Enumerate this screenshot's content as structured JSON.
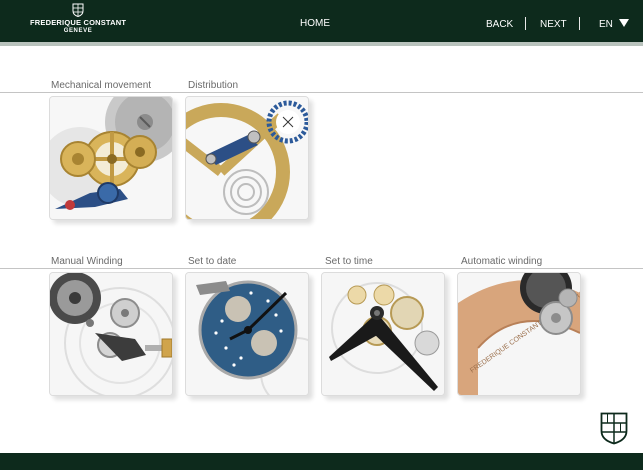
{
  "header": {
    "brand": "FREDERIQUE CONSTANT",
    "city": "GENEVE",
    "nav": {
      "home": "HOME",
      "back": "BACK",
      "next": "NEXT",
      "language": "EN"
    }
  },
  "sections": [
    {
      "items": [
        {
          "label": "Mechanical movement",
          "image": "gear-train-illustration"
        },
        {
          "label": "Distribution",
          "image": "balance-wheel-illustration"
        }
      ]
    },
    {
      "items": [
        {
          "label": "Manual Winding",
          "image": "crown-winding-illustration"
        },
        {
          "label": "Set to date",
          "image": "date-disc-illustration"
        },
        {
          "label": "Set to time",
          "image": "watch-hands-illustration"
        },
        {
          "label": "Automatic winding",
          "image": "rotor-illustration"
        }
      ]
    }
  ],
  "colors": {
    "header_bg": "#0d2a1c",
    "header_stripe": "#b9c3bd",
    "label_text": "#6a6a6a",
    "gold": "#c9a85a",
    "steel_blue": "#2c4f86"
  }
}
